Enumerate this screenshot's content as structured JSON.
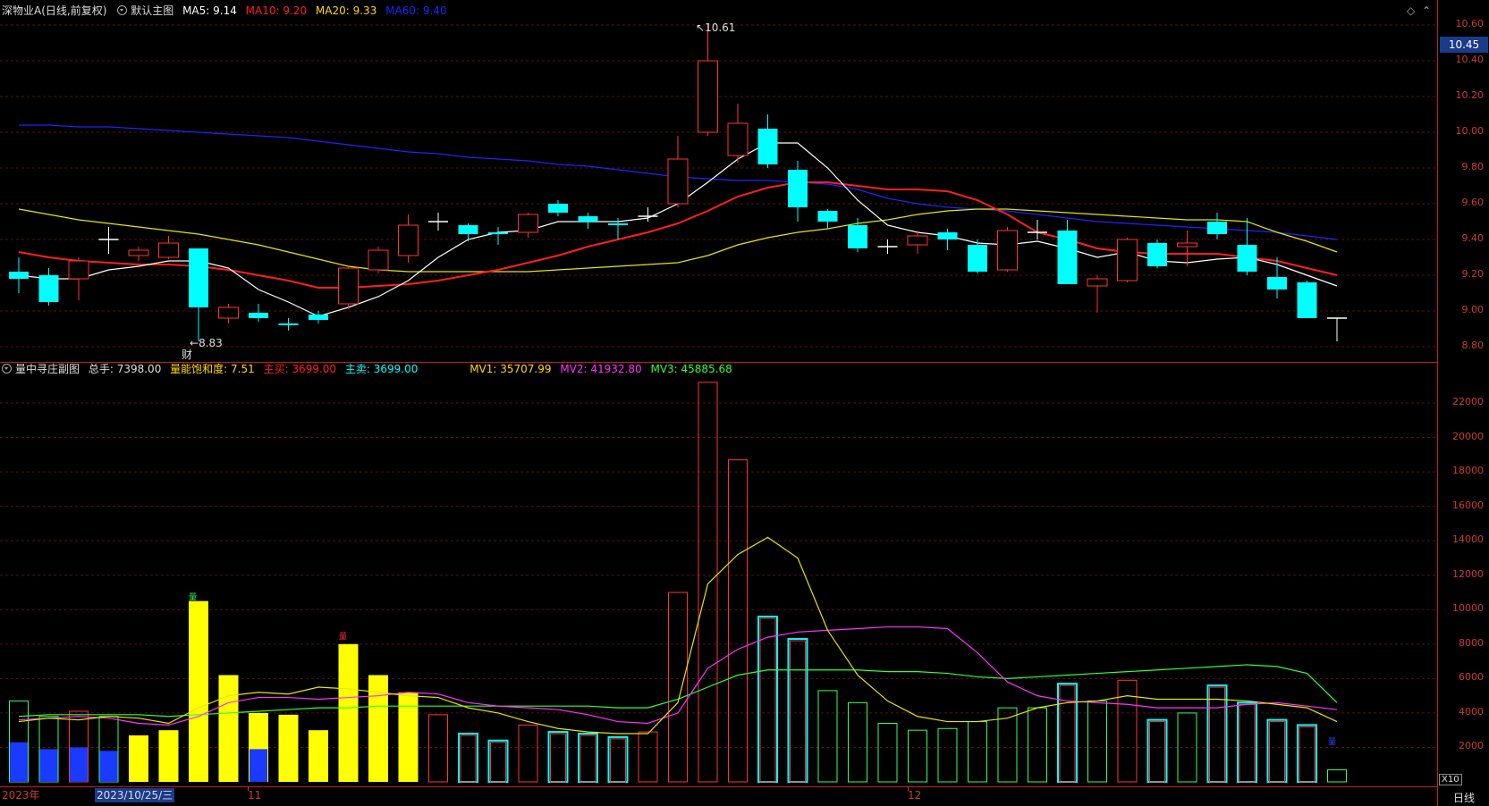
{
  "header": {
    "stock_title": "深物业A(日线,前复权)",
    "main_chart_label": "默认主图",
    "ma": [
      {
        "label": "MA5: 9.14",
        "color": "#ffffff"
      },
      {
        "label": "MA10: 9.20",
        "color": "#ff2020"
      },
      {
        "label": "MA20: 9.33",
        "color": "#ffd800"
      },
      {
        "label": "MA60: 9.40",
        "color": "#2222ff"
      }
    ]
  },
  "sub_header": {
    "indicator_name": "量中寻庄副图",
    "total_hands": "总手: 7398.00",
    "saturation": "量能饱和度: 7.51",
    "main_buy": "主买: 3699.00",
    "main_sell": "主卖: 3699.00",
    "mv1": "MV1: 35707.99",
    "mv2": "MV2: 41932.80",
    "mv3": "MV3: 45885.68"
  },
  "price_axis": [
    "10.60",
    "10.40",
    "10.20",
    "10.00",
    "9.80",
    "9.60",
    "9.40",
    "9.20",
    "9.00",
    "8.80"
  ],
  "current_price": "10.45",
  "volume_axis": [
    "22000",
    "20000",
    "18000",
    "16000",
    "14000",
    "12000",
    "10000",
    "8000",
    "6000",
    "4000",
    "2000"
  ],
  "annotations": {
    "high_label": "10.61",
    "low_label": "8.83",
    "finance_marker": "财",
    "volume_marker_1": "量",
    "volume_marker_2": "量",
    "volume_marker_3": "量"
  },
  "time_axis": {
    "year_label": "2023年",
    "date_label": "2023/10/25/三",
    "month_11": "11",
    "month_12": "12"
  },
  "period_label": "日线",
  "scale_button": "X10",
  "colors": {
    "up": "#ff3333",
    "down": "#00ffff",
    "ma5": "#ffffff",
    "ma10": "#ff2020",
    "ma20": "#e6e600",
    "ma60": "#2222ff",
    "vol_yellow": "#ffff00",
    "vol_green": "#33ff66",
    "vol_blue": "#1a3aff",
    "mv1": "#e6e600",
    "mv2": "#ff33ff",
    "mv3": "#33ff33"
  },
  "chart_data": {
    "type": "candlestick",
    "title": "深物业A(日线,前复权)",
    "candles": [
      {
        "o": 9.22,
        "c": 9.18,
        "h": 9.3,
        "l": 9.1
      },
      {
        "o": 9.2,
        "c": 9.05,
        "h": 9.24,
        "l": 9.03
      },
      {
        "o": 9.18,
        "c": 9.28,
        "h": 9.3,
        "l": 9.06
      },
      {
        "o": 9.4,
        "c": 9.4,
        "h": 9.47,
        "l": 9.32
      },
      {
        "o": 9.31,
        "c": 9.34,
        "h": 9.36,
        "l": 9.28
      },
      {
        "o": 9.3,
        "c": 9.38,
        "h": 9.42,
        "l": 9.29
      },
      {
        "o": 9.35,
        "c": 9.02,
        "h": 9.35,
        "l": 8.83
      },
      {
        "o": 8.96,
        "c": 9.02,
        "h": 9.04,
        "l": 8.93
      },
      {
        "o": 8.99,
        "c": 8.96,
        "h": 9.04,
        "l": 8.94
      },
      {
        "o": 8.93,
        "c": 8.92,
        "h": 8.96,
        "l": 8.89
      },
      {
        "o": 8.98,
        "c": 8.95,
        "h": 9.0,
        "l": 8.93
      },
      {
        "o": 9.04,
        "c": 9.24,
        "h": 9.25,
        "l": 9.01
      },
      {
        "o": 9.23,
        "c": 9.34,
        "h": 9.36,
        "l": 9.21
      },
      {
        "o": 9.31,
        "c": 9.48,
        "h": 9.54,
        "l": 9.27
      },
      {
        "o": 9.5,
        "c": 9.5,
        "h": 9.55,
        "l": 9.45
      },
      {
        "o": 9.48,
        "c": 9.43,
        "h": 9.49,
        "l": 9.39
      },
      {
        "o": 9.44,
        "c": 9.43,
        "h": 9.47,
        "l": 9.37
      },
      {
        "o": 9.44,
        "c": 9.54,
        "h": 9.55,
        "l": 9.41
      },
      {
        "o": 9.6,
        "c": 9.55,
        "h": 9.62,
        "l": 9.53
      },
      {
        "o": 9.53,
        "c": 9.5,
        "h": 9.55,
        "l": 9.46
      },
      {
        "o": 9.49,
        "c": 9.48,
        "h": 9.52,
        "l": 9.4
      },
      {
        "o": 9.53,
        "c": 9.53,
        "h": 9.58,
        "l": 9.5
      },
      {
        "o": 9.6,
        "c": 9.85,
        "h": 9.98,
        "l": 9.58
      },
      {
        "o": 10.0,
        "c": 10.4,
        "h": 10.61,
        "l": 9.98
      },
      {
        "o": 9.87,
        "c": 10.05,
        "h": 10.16,
        "l": 9.83
      },
      {
        "o": 10.02,
        "c": 9.82,
        "h": 10.1,
        "l": 9.8
      },
      {
        "o": 9.79,
        "c": 9.58,
        "h": 9.84,
        "l": 9.5
      },
      {
        "o": 9.56,
        "c": 9.5,
        "h": 9.57,
        "l": 9.46
      },
      {
        "o": 9.48,
        "c": 9.35,
        "h": 9.52,
        "l": 9.33
      },
      {
        "o": 9.36,
        "c": 9.36,
        "h": 9.4,
        "l": 9.32
      },
      {
        "o": 9.37,
        "c": 9.42,
        "h": 9.45,
        "l": 9.32
      },
      {
        "o": 9.44,
        "c": 9.4,
        "h": 9.46,
        "l": 9.34
      },
      {
        "o": 9.37,
        "c": 9.22,
        "h": 9.4,
        "l": 9.21
      },
      {
        "o": 9.23,
        "c": 9.45,
        "h": 9.47,
        "l": 9.22
      },
      {
        "o": 9.44,
        "c": 9.44,
        "h": 9.51,
        "l": 9.4
      },
      {
        "o": 9.45,
        "c": 9.15,
        "h": 9.51,
        "l": 9.15
      },
      {
        "o": 9.14,
        "c": 9.18,
        "h": 9.2,
        "l": 8.99
      },
      {
        "o": 9.17,
        "c": 9.4,
        "h": 9.41,
        "l": 9.16
      },
      {
        "o": 9.38,
        "c": 9.25,
        "h": 9.4,
        "l": 9.24
      },
      {
        "o": 9.36,
        "c": 9.38,
        "h": 9.45,
        "l": 9.25
      },
      {
        "o": 9.5,
        "c": 9.43,
        "h": 9.55,
        "l": 9.4
      },
      {
        "o": 9.37,
        "c": 9.22,
        "h": 9.52,
        "l": 9.2
      },
      {
        "o": 9.19,
        "c": 9.12,
        "h": 9.3,
        "l": 9.07
      },
      {
        "o": 9.16,
        "c": 8.96,
        "h": 9.17,
        "l": 8.96
      },
      {
        "o": 8.96,
        "c": 8.96,
        "h": 8.96,
        "l": 8.83
      }
    ],
    "ma5": [
      9.2,
      9.18,
      9.18,
      9.23,
      9.25,
      9.28,
      9.28,
      9.24,
      9.12,
      9.05,
      8.97,
      9.02,
      9.08,
      9.17,
      9.3,
      9.4,
      9.44,
      9.45,
      9.5,
      9.5,
      9.5,
      9.52,
      9.6,
      9.72,
      9.85,
      9.94,
      9.94,
      9.8,
      9.62,
      9.48,
      9.44,
      9.42,
      9.38,
      9.37,
      9.39,
      9.35,
      9.3,
      9.33,
      9.28,
      9.27,
      9.29,
      9.3,
      9.26,
      9.2,
      9.14
    ],
    "ma10": [
      9.33,
      9.3,
      9.28,
      9.27,
      9.26,
      9.26,
      9.25,
      9.23,
      9.2,
      9.17,
      9.13,
      9.13,
      9.14,
      9.15,
      9.17,
      9.2,
      9.23,
      9.27,
      9.31,
      9.36,
      9.4,
      9.44,
      9.49,
      9.56,
      9.64,
      9.69,
      9.72,
      9.72,
      9.7,
      9.68,
      9.68,
      9.67,
      9.62,
      9.54,
      9.44,
      9.4,
      9.35,
      9.33,
      9.32,
      9.32,
      9.32,
      9.3,
      9.28,
      9.24,
      9.2
    ],
    "ma20": [
      9.57,
      9.54,
      9.51,
      9.49,
      9.47,
      9.45,
      9.43,
      9.4,
      9.37,
      9.33,
      9.29,
      9.25,
      9.23,
      9.22,
      9.22,
      9.22,
      9.22,
      9.22,
      9.23,
      9.24,
      9.25,
      9.26,
      9.27,
      9.31,
      9.37,
      9.41,
      9.44,
      9.46,
      9.49,
      9.51,
      9.54,
      9.56,
      9.57,
      9.57,
      9.56,
      9.55,
      9.54,
      9.53,
      9.52,
      9.51,
      9.51,
      9.5,
      9.44,
      9.39,
      9.33
    ],
    "ma60": [
      10.04,
      10.04,
      10.03,
      10.03,
      10.02,
      10.01,
      10.0,
      9.99,
      9.98,
      9.97,
      9.95,
      9.93,
      9.91,
      9.89,
      9.88,
      9.86,
      9.85,
      9.84,
      9.82,
      9.81,
      9.79,
      9.77,
      9.75,
      9.74,
      9.73,
      9.73,
      9.72,
      9.71,
      9.68,
      9.63,
      9.6,
      9.58,
      9.57,
      9.56,
      9.54,
      9.52,
      9.5,
      9.49,
      9.48,
      9.47,
      9.46,
      9.45,
      9.44,
      9.42,
      9.4
    ],
    "volume": [
      4700,
      3800,
      4100,
      3800,
      2700,
      3000,
      10500,
      6200,
      4000,
      3900,
      3000,
      8000,
      6200,
      5200,
      3900,
      2800,
      2400,
      3300,
      2900,
      2800,
      2600,
      2900,
      11000,
      23200,
      18700,
      9600,
      8300,
      5300,
      4600,
      3400,
      3000,
      3100,
      3500,
      4300,
      4300,
      5700,
      4700,
      5900,
      3600,
      4000,
      5600,
      4600,
      3600,
      3300,
      700
    ],
    "vol_styles": [
      "g",
      "g",
      "r",
      "g",
      "y",
      "y",
      "y",
      "y",
      "y",
      "y",
      "y",
      "y",
      "y",
      "y",
      "r",
      "c",
      "c",
      "r",
      "c",
      "c",
      "c",
      "r",
      "r",
      "r",
      "r",
      "c",
      "c",
      "g",
      "g",
      "g",
      "g",
      "g",
      "g",
      "g",
      "g",
      "c",
      "g",
      "r",
      "c",
      "g",
      "c",
      "c",
      "c",
      "c",
      "g"
    ],
    "vol_inner_blue": [
      2300,
      1900,
      2000,
      1800,
      0,
      0,
      0,
      0,
      1900,
      0,
      0,
      0,
      0,
      0,
      0,
      0,
      0,
      0,
      0,
      0,
      0,
      0,
      0,
      0,
      0,
      0,
      0,
      0,
      0,
      0,
      0,
      0,
      0,
      0,
      0,
      0,
      0,
      0,
      0,
      0,
      0,
      0,
      0,
      0,
      0
    ],
    "mv1": [
      3500,
      3700,
      3600,
      3800,
      3700,
      3400,
      4300,
      5000,
      5200,
      5100,
      5500,
      5400,
      5200,
      5000,
      4900,
      4300,
      4000,
      3500,
      3100,
      2900,
      2800,
      2800,
      4600,
      11500,
      13200,
      14200,
      13000,
      8800,
      6200,
      4700,
      3800,
      3500,
      3500,
      3700,
      4300,
      4600,
      4700,
      5000,
      4800,
      4800,
      4800,
      4700,
      4500,
      4300,
      3500
    ],
    "mv2": [
      3600,
      3700,
      3800,
      3700,
      3400,
      3300,
      3800,
      4600,
      4900,
      4900,
      4800,
      4900,
      5000,
      5200,
      5100,
      4600,
      4400,
      4300,
      4200,
      3900,
      3500,
      3400,
      4000,
      6600,
      7700,
      8400,
      8700,
      8800,
      8900,
      9000,
      9000,
      8900,
      7500,
      5800,
      5000,
      4700,
      4600,
      4500,
      4300,
      4300,
      4300,
      4500,
      4600,
      4400,
      4200
    ],
    "mv3": [
      3800,
      3900,
      3900,
      3900,
      3900,
      3800,
      3900,
      4000,
      4100,
      4200,
      4300,
      4300,
      4400,
      4400,
      4400,
      4400,
      4400,
      4400,
      4400,
      4400,
      4300,
      4300,
      4800,
      5500,
      6200,
      6500,
      6500,
      6500,
      6500,
      6400,
      6400,
      6300,
      6100,
      6000,
      6100,
      6200,
      6300,
      6400,
      6500,
      6600,
      6700,
      6800,
      6700,
      6300,
      4600
    ]
  }
}
